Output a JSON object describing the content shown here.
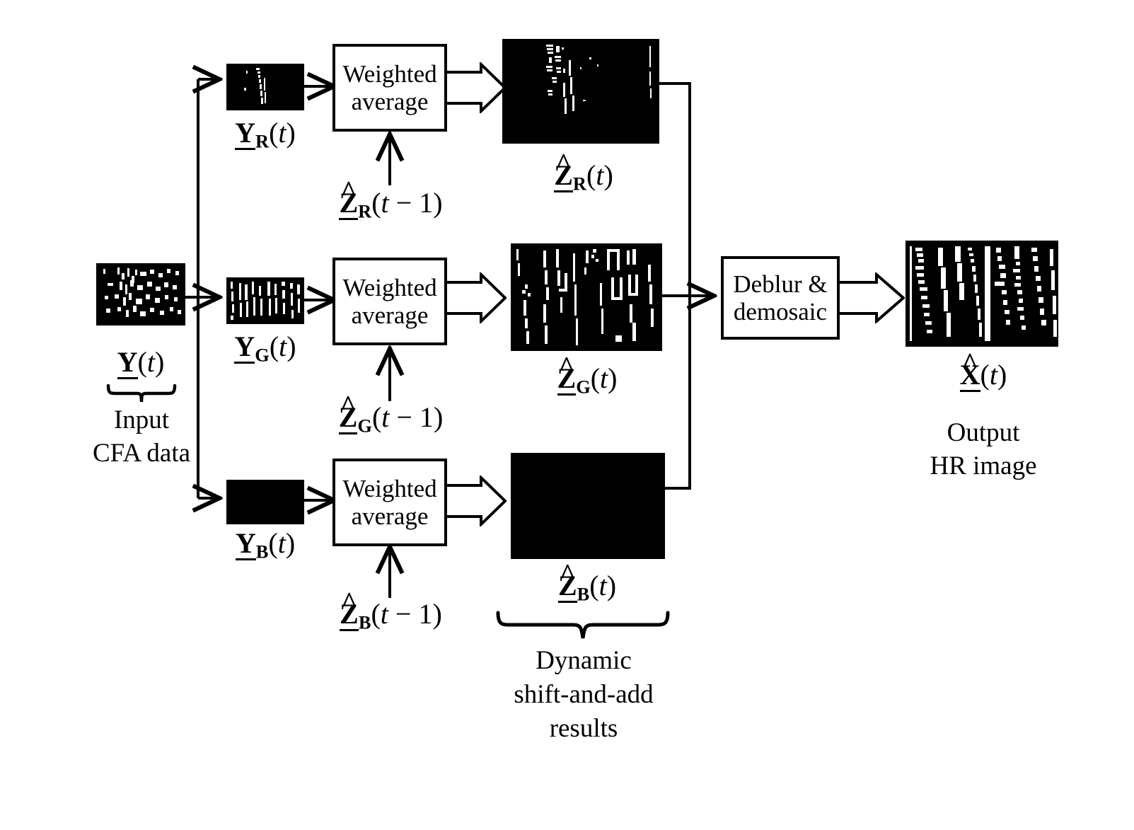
{
  "diagram": {
    "title_present": false,
    "ink_color": "#000000",
    "background": "#ffffff"
  },
  "input": {
    "image_name": "cfa-input-thumbnail",
    "symbol_html": "<span class=\"vec\">Y</span>(<span class=\"it\">t</span>)",
    "caption_line1": "Input",
    "caption_line2": "CFA data"
  },
  "channels": [
    {
      "id": "red",
      "channel_letter": "R",
      "input_thumb_name": "y-r-thumbnail",
      "input_symbol_html": "<span class=\"vec\">Y</span><sub>R</sub>(<span class=\"it\">t</span>)",
      "process_line1": "Weighted",
      "process_line2": "average",
      "feedback_symbol_html": "<span class=\"vec\"><span class=\"hat\">^</span>Z</span><sub>R</sub>(<span class=\"it\">t</span> &minus; 1)",
      "output_thumb_name": "z-r-thumbnail",
      "output_symbol_html": "<span class=\"vec\"><span class=\"hat\">^</span>Z</span><sub>R</sub>(<span class=\"it\">t</span>)"
    },
    {
      "id": "green",
      "channel_letter": "G",
      "input_thumb_name": "y-g-thumbnail",
      "input_symbol_html": "<span class=\"vec\">Y</span><sub>G</sub>(<span class=\"it\">t</span>)",
      "process_line1": "Weighted",
      "process_line2": "average",
      "feedback_symbol_html": "<span class=\"vec\"><span class=\"hat\">^</span>Z</span><sub>G</sub>(<span class=\"it\">t</span> &minus; 1)",
      "output_thumb_name": "z-g-thumbnail",
      "output_symbol_html": "<span class=\"vec\"><span class=\"hat\">^</span>Z</span><sub>G</sub>(<span class=\"it\">t</span>)"
    },
    {
      "id": "blue",
      "channel_letter": "B",
      "input_thumb_name": "y-b-thumbnail",
      "input_symbol_html": "<span class=\"vec\">Y</span><sub>B</sub>(<span class=\"it\">t</span>)",
      "process_line1": "Weighted",
      "process_line2": "average",
      "feedback_symbol_html": "<span class=\"vec\"><span class=\"hat\">^</span>Z</span><sub>B</sub>(<span class=\"it\">t</span> &minus; 1)",
      "output_thumb_name": "z-b-thumbnail",
      "output_symbol_html": "<span class=\"vec\"><span class=\"hat\">^</span>Z</span><sub>B</sub>(<span class=\"it\">t</span>)"
    }
  ],
  "shift_and_add": {
    "caption_line1": "Dynamic",
    "caption_line2": "shift-and-add",
    "caption_line3": "results"
  },
  "deblur": {
    "line1": "Deblur &",
    "line2": "demosaic"
  },
  "output": {
    "image_name": "hr-output-thumbnail",
    "symbol_html": "<span class=\"vec\"><span class=\"hat\">^</span>X</span>(<span class=\"it\">t</span>)",
    "caption_line1": "Output",
    "caption_line2": "HR image"
  }
}
